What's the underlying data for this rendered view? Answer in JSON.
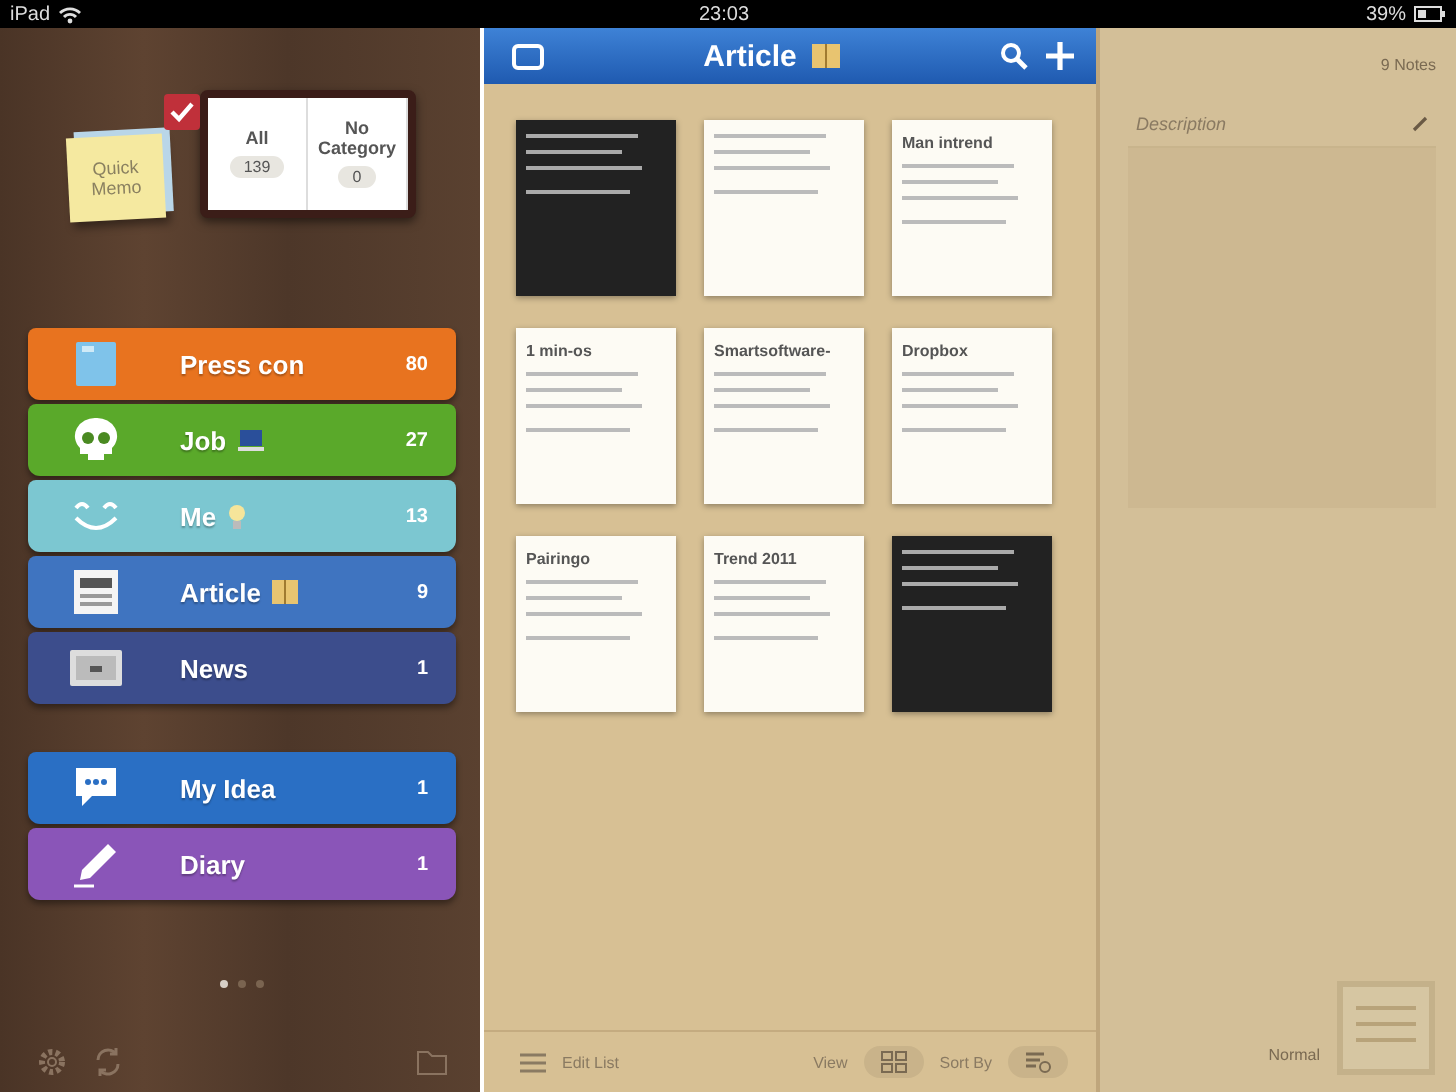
{
  "status_bar": {
    "device": "iPad",
    "time": "23:03",
    "battery": "39%"
  },
  "sidebar": {
    "quick_memo": "Quick Memo",
    "book": {
      "checked": true,
      "pages": [
        {
          "label": "All",
          "count": "139"
        },
        {
          "label": "No Category",
          "count": "0"
        }
      ]
    },
    "groups": [
      [
        {
          "name": "Press con",
          "count": "80",
          "color": "#e8731f"
        },
        {
          "name": "Job",
          "count": "27",
          "color": "#5aa92a"
        },
        {
          "name": "Me",
          "count": "13",
          "color": "#7cc7d1"
        },
        {
          "name": "Article",
          "count": "9",
          "color": "#3f74c0"
        },
        {
          "name": "News",
          "count": "1",
          "color": "#3c4d8c"
        }
      ],
      [
        {
          "name": "My Idea",
          "count": "1",
          "color": "#2a6fc4"
        },
        {
          "name": "Diary",
          "count": "1",
          "color": "#8a55b8"
        }
      ]
    ],
    "pages": [
      {
        "selected": true
      },
      {
        "selected": false
      },
      {
        "selected": false
      }
    ]
  },
  "main": {
    "title": "Article",
    "notes": [
      {
        "kind": "dark"
      },
      {
        "kind": "light"
      },
      {
        "kind": "light",
        "title": "Man intrend"
      },
      {
        "kind": "light",
        "title": "1 min-os"
      },
      {
        "kind": "light",
        "title": "Smartsoftware-"
      },
      {
        "kind": "light",
        "title": "Dropbox"
      },
      {
        "kind": "light",
        "title": "Pairingo"
      },
      {
        "kind": "light",
        "title": "Trend 2011"
      },
      {
        "kind": "dark"
      }
    ],
    "toolbar": {
      "edit": "Edit List",
      "view": "View",
      "sort": "Sort By"
    }
  },
  "detail": {
    "count": "9 Notes",
    "description": "Description",
    "style": "Normal"
  }
}
